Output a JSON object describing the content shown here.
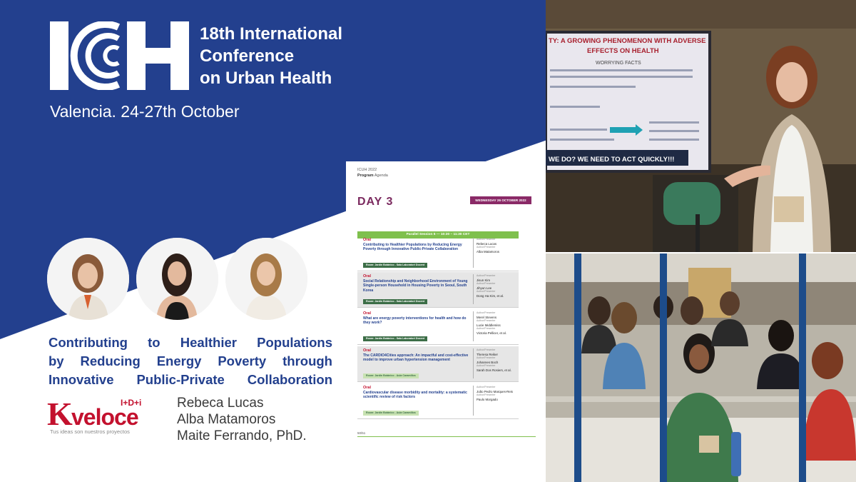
{
  "header": {
    "title_lines": [
      "18th International",
      "Conference",
      "on Urban Health"
    ],
    "date": "Valencia. 24-27th October"
  },
  "speakers": [
    {
      "name": "speaker-1",
      "hair": "#8a5a3a",
      "top": "#e8e1d6",
      "skin": "#e8c2a6"
    },
    {
      "name": "speaker-2",
      "hair": "#2e1f19",
      "top": "#1a1a1a",
      "skin": "#e3b99d"
    },
    {
      "name": "speaker-3",
      "hair": "#a87a48",
      "top": "#f1ece4",
      "skin": "#ebc6aa"
    }
  ],
  "talk": {
    "title_lines": [
      "Contributing to Healthier Populations",
      "by Reducing Energy Poverty through",
      "Innovative Public-Private Collaboration"
    ]
  },
  "sponsor": {
    "mark": "K",
    "word": "veloce",
    "sup": "I+D+i",
    "tagline": "Tus ideas son nuestros proyectos"
  },
  "authors": [
    "Rebeca Lucas",
    "Alba Matamoros",
    "Maite Ferrando, PhD."
  ],
  "program": {
    "header_event": "ICUH 2022",
    "header_section": "Program",
    "header_sub": "Agenda",
    "day": "DAY 3",
    "date_badge": "WEDNESDAY 26 OCTOBER 2022",
    "session": "Parallel Session 5 — 10:30 – 11:30 CET",
    "page_no": "50/51",
    "rows": [
      {
        "type": "Oral",
        "title": "Contributing to Healthier Populations by Reducing Energy Poverty through Innovative Public-Private Collaboration",
        "room": "Room: Jardín Botánico - Sala Laboratori Docent",
        "people": [
          "Rebeca Lucas",
          "Alba Matamoros"
        ]
      },
      {
        "type": "Oral",
        "title": "Social Relationship and Neighborhood Environment of Young Single-person Household in Housing Poverty in Seoul, South Korea",
        "room": "Room: Jardín Botánico - Sala Laboratori Docent",
        "people": [
          "Jisun Kim",
          "Jihyun Lee",
          "Dong Ha Kim, et al."
        ]
      },
      {
        "type": "Oral",
        "title": "What are energy poverty interventions for health and how do they work?",
        "room": "Room: Jardín Botánico - Sala Laboratori Docent",
        "people": [
          "Merel Stevens",
          "Lucie Middlemiss",
          "Victoria Pellicer, et al."
        ]
      },
      {
        "type": "Oral",
        "title": "The CARDIO4Cities approach: An impactful and cost-effective model to improve urban hypertension management",
        "room": "Room: Jardín Botánico - Aula Caramillos",
        "people": [
          "Theresa Reiker",
          "Johannes Boch",
          "Sarah Dos Rosiers, et al."
        ]
      },
      {
        "type": "Oral",
        "title": "Cardiovascular disease morbidity and mortality: a systematic scientific review of risk factors",
        "room": "Room: Jardín Botánico - Aula Caramillos",
        "people": [
          "João Pedro Marques-Reis",
          "Paulo Morgado"
        ]
      }
    ],
    "author_label": "Author/Presenter"
  },
  "slide": {
    "title_line1": "TY: A GROWING PHENOMENON WITH ADVERSE",
    "title_line2": "EFFECTS ON HEALTH",
    "subhead": "WORRYING FACTS",
    "banner": "WE DO? WE NEED TO ACT QUICKLY!!!"
  },
  "colors": {
    "brand_blue": "#23408e",
    "accent_red": "#c3112e",
    "day_purple": "#7b2a5f",
    "session_green": "#7fc04d"
  }
}
